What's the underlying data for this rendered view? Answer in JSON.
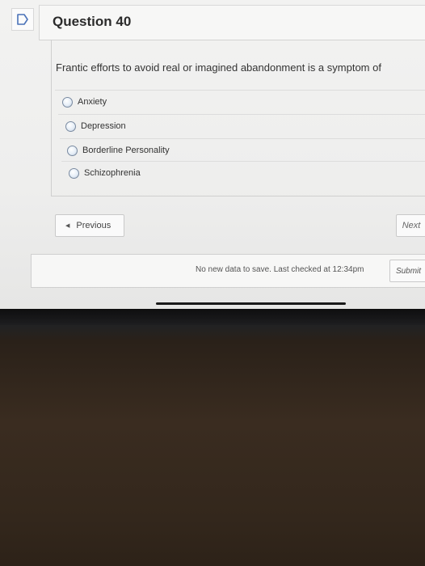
{
  "question": {
    "title": "Question 40",
    "prompt": "Frantic efforts to avoid real or imagined abandonment is a symptom of",
    "answers": [
      {
        "label": "Anxiety"
      },
      {
        "label": "Depression"
      },
      {
        "label": "Borderline Personality"
      },
      {
        "label": "Schizophrenia"
      }
    ]
  },
  "navigation": {
    "previous_label": "Previous",
    "next_label": "Next"
  },
  "save_bar": {
    "status_text": "No new data to save. Last checked at 12:34pm",
    "submit_label": "Submit"
  },
  "icons": {
    "question_status": "flag-outline-icon",
    "previous_arrow": "left-triangle-icon"
  },
  "colors": {
    "question_icon_stroke": "#4a72b8"
  }
}
